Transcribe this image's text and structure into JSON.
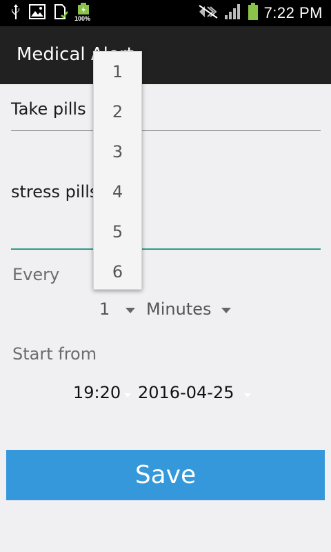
{
  "status_bar": {
    "time": "7:22 PM",
    "battery_small_label": "100%",
    "icons": [
      "usb-icon",
      "image-icon",
      "sd-card-icon",
      "battery-icon",
      "mute-icon",
      "signal-icon",
      "battery-icon"
    ]
  },
  "action_bar": {
    "title": "Medical Alert"
  },
  "form": {
    "field1_value": "Take pills",
    "field2_value": "stress pills",
    "every_label": "Every",
    "every_value": "1",
    "unit_value": "Minutes",
    "start_label": "Start from",
    "start_time": "19:20",
    "start_date": "2016-04-25"
  },
  "save_button": {
    "label": "Save"
  },
  "dropdown": {
    "options": [
      "1",
      "2",
      "3",
      "4",
      "5",
      "6"
    ]
  },
  "colors": {
    "accent": "#3498db",
    "underline_active": "#2a9d8f",
    "action_bar": "#212121"
  }
}
